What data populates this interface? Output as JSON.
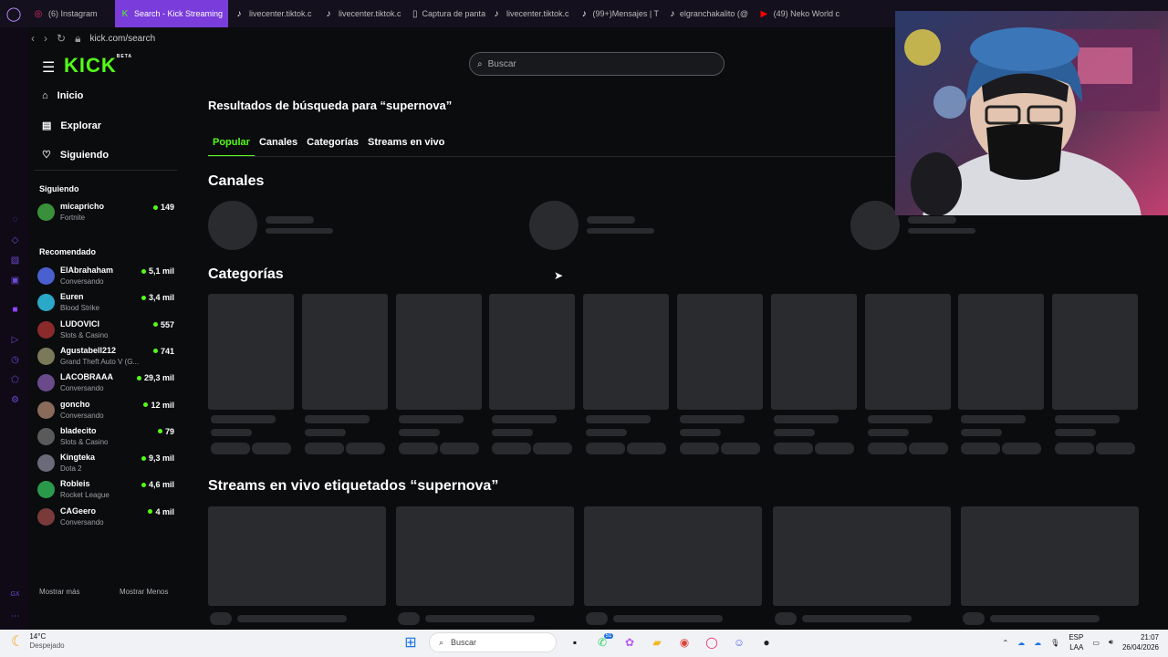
{
  "browser": {
    "tabs": [
      {
        "label": "(6) Instagram",
        "icon": "instagram-icon"
      },
      {
        "label": "Search - Kick Streaming",
        "icon": "kick-icon",
        "active": true
      },
      {
        "label": "livecenter.tiktok.c",
        "icon": "tiktok-icon"
      },
      {
        "label": "livecenter.tiktok.c",
        "icon": "tiktok-icon"
      },
      {
        "label": "Captura de panta",
        "icon": "document-icon"
      },
      {
        "label": "livecenter.tiktok.c",
        "icon": "tiktok-icon"
      },
      {
        "label": "(99+)Mensajes | T",
        "icon": "tiktok-icon"
      },
      {
        "label": "elgranchakalito (@",
        "icon": "tiktok-icon"
      },
      {
        "label": "(49) Neko World c",
        "icon": "youtube-icon"
      }
    ],
    "url": "kick.com/search"
  },
  "sidebar": {
    "logo": "KICK",
    "logo_badge": "BETA",
    "nav": [
      {
        "label": "Inicio",
        "icon": "home-icon"
      },
      {
        "label": "Explorar",
        "icon": "explore-icon"
      },
      {
        "label": "Siguiendo",
        "icon": "heart-icon"
      }
    ],
    "following_title": "Siguiendo",
    "following": [
      {
        "name": "micapricho",
        "game": "Fortnite",
        "viewers": "149"
      }
    ],
    "recommended_title": "Recomendado",
    "recommended": [
      {
        "name": "ElAbrahaham",
        "game": "Conversando",
        "viewers": "5,1 mil"
      },
      {
        "name": "Euren",
        "game": "Blood Strike",
        "viewers": "3,4 mil"
      },
      {
        "name": "LUDOVICI",
        "game": "Slots & Casino",
        "viewers": "557"
      },
      {
        "name": "Agustabell212",
        "game": "Grand Theft Auto V (G...",
        "viewers": "741"
      },
      {
        "name": "LACOBRAAA",
        "game": "Conversando",
        "viewers": "29,3 mil"
      },
      {
        "name": "goncho",
        "game": "Conversando",
        "viewers": "12 mil"
      },
      {
        "name": "bladecito",
        "game": "Slots & Casino",
        "viewers": "79"
      },
      {
        "name": "Kingteka",
        "game": "Dota 2",
        "viewers": "9,3 mil"
      },
      {
        "name": "Robleis",
        "game": "Rocket League",
        "viewers": "4,6 mil"
      },
      {
        "name": "CAGeero",
        "game": "Conversando",
        "viewers": "4 mil"
      }
    ],
    "show_more": "Mostrar más",
    "show_less": "Mostrar Menos"
  },
  "search": {
    "placeholder": "Buscar"
  },
  "main": {
    "results_title": "Resultados de búsqueda para “supernova”",
    "tabs": [
      "Popular",
      "Canales",
      "Categorías",
      "Streams en vivo"
    ],
    "channels_title": "Canales",
    "categories_title": "Categorías",
    "streams_title": "Streams en vivo etiquetados “supernova”"
  },
  "taskbar": {
    "temp": "14°C",
    "weather": "Despejado",
    "search": "Buscar",
    "lang1": "ESP",
    "lang2": "LAA",
    "time": "21:07",
    "date": "26/04/2026",
    "discord_badge": "51"
  },
  "colors": {
    "accent": "#53fc18",
    "bg": "#0b0c0e",
    "placeholder": "#2a2b2f"
  }
}
